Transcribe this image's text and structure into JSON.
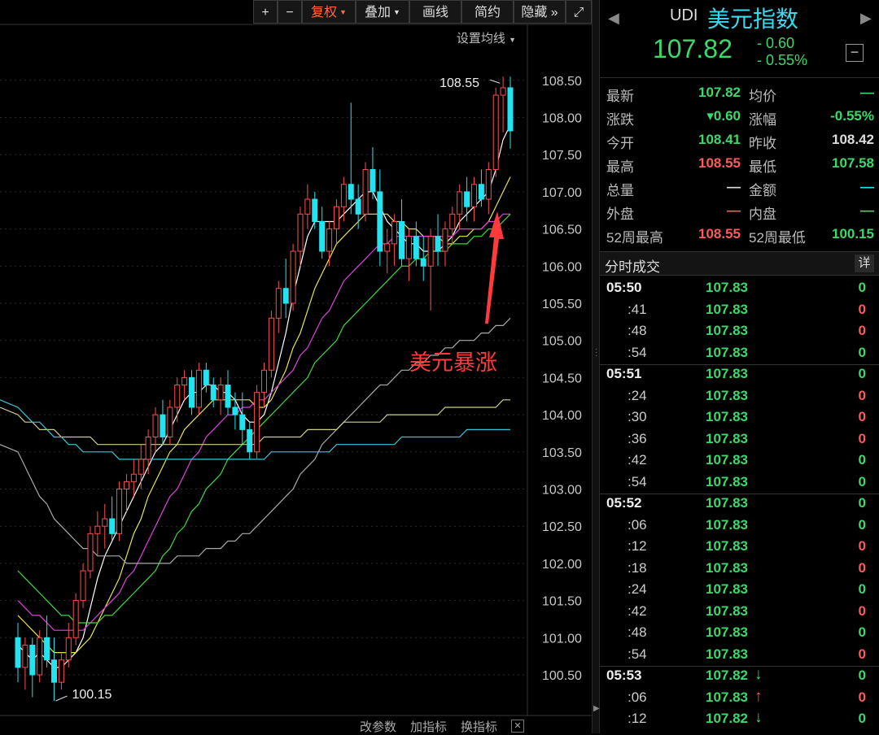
{
  "toolbar": {
    "plus": "+",
    "minus": "−",
    "fuquan": "复权",
    "diejia": "叠加",
    "huaxian": "画线",
    "jiandian": "简约",
    "yincang": "隐藏",
    "more": "»",
    "expand": "⤢"
  },
  "chart": {
    "ma_settings": "设置均线",
    "bottom_tools": [
      "改参数",
      "加指标",
      "换指标"
    ],
    "close_x": "✕",
    "annotation": "美元暴涨",
    "high_label": "108.55",
    "low_label": "100.15",
    "colors": {
      "up": "#ff4d4d",
      "down": "#22e4f0",
      "ma5": "#ffffff",
      "ma10": "#e6e64a",
      "ma20": "#e040e0",
      "ma30": "#3ed93e",
      "ma60": "#aaaaaa",
      "ma120": "#cfcf8a",
      "ma250": "#3bc4d8",
      "annotation": "#ff3a3a"
    }
  },
  "chart_data": {
    "type": "candlestick",
    "y_tick_labels": [
      "108.50",
      "108.00",
      "107.50",
      "107.00",
      "106.50",
      "106.00",
      "105.50",
      "105.00",
      "104.50",
      "104.00",
      "103.50",
      "103.00",
      "102.50",
      "102.00",
      "101.50",
      "101.00",
      "100.50"
    ],
    "ylim": [
      100.2,
      108.7
    ],
    "highest": 108.55,
    "lowest": 100.15,
    "candles": [
      [
        101.0,
        101.2,
        100.4,
        100.6
      ],
      [
        100.6,
        101.0,
        100.3,
        100.9
      ],
      [
        100.9,
        101.0,
        100.2,
        100.5
      ],
      [
        100.5,
        101.1,
        100.4,
        101.0
      ],
      [
        101.0,
        101.3,
        100.6,
        100.7
      ],
      [
        100.7,
        101.0,
        100.15,
        100.4
      ],
      [
        100.4,
        100.8,
        100.3,
        100.7
      ],
      [
        100.7,
        101.2,
        100.6,
        101.0
      ],
      [
        101.0,
        101.6,
        100.9,
        101.5
      ],
      [
        101.5,
        102.0,
        101.4,
        101.9
      ],
      [
        101.9,
        102.5,
        101.8,
        102.4
      ],
      [
        102.4,
        102.7,
        102.1,
        102.5
      ],
      [
        102.5,
        102.8,
        102.2,
        102.6
      ],
      [
        102.6,
        102.9,
        102.3,
        102.4
      ],
      [
        102.4,
        103.1,
        102.3,
        103.0
      ],
      [
        103.0,
        103.2,
        102.7,
        103.1
      ],
      [
        103.1,
        103.4,
        102.9,
        103.2
      ],
      [
        103.2,
        103.6,
        103.0,
        103.4
      ],
      [
        103.4,
        103.8,
        103.2,
        103.7
      ],
      [
        103.7,
        104.1,
        103.5,
        104.0
      ],
      [
        104.0,
        104.2,
        103.6,
        103.7
      ],
      [
        103.7,
        104.2,
        103.6,
        104.1
      ],
      [
        104.1,
        104.5,
        103.9,
        104.4
      ],
      [
        104.4,
        104.6,
        104.2,
        104.5
      ],
      [
        104.5,
        104.6,
        104.0,
        104.1
      ],
      [
        104.1,
        104.7,
        104.0,
        104.6
      ],
      [
        104.6,
        104.7,
        104.3,
        104.4
      ],
      [
        104.4,
        104.5,
        104.1,
        104.2
      ],
      [
        104.2,
        104.5,
        104.0,
        104.4
      ],
      [
        104.4,
        104.6,
        104.0,
        104.1
      ],
      [
        104.1,
        104.3,
        103.8,
        104.0
      ],
      [
        104.0,
        104.3,
        103.6,
        103.8
      ],
      [
        103.8,
        103.9,
        103.4,
        103.5
      ],
      [
        103.5,
        104.4,
        103.4,
        104.3
      ],
      [
        104.3,
        104.7,
        104.1,
        104.6
      ],
      [
        104.6,
        105.4,
        104.5,
        105.3
      ],
      [
        105.3,
        105.8,
        105.1,
        105.7
      ],
      [
        105.7,
        106.1,
        105.3,
        105.5
      ],
      [
        105.5,
        106.3,
        105.4,
        106.2
      ],
      [
        106.2,
        106.8,
        106.0,
        106.7
      ],
      [
        106.7,
        107.1,
        106.5,
        106.9
      ],
      [
        106.9,
        107.0,
        106.5,
        106.6
      ],
      [
        106.6,
        106.8,
        106.1,
        106.2
      ],
      [
        106.2,
        106.6,
        106.0,
        106.5
      ],
      [
        106.5,
        106.9,
        106.3,
        106.8
      ],
      [
        106.8,
        107.2,
        106.6,
        107.1
      ],
      [
        107.1,
        108.2,
        106.7,
        106.9
      ],
      [
        106.9,
        107.1,
        106.5,
        106.7
      ],
      [
        106.7,
        107.4,
        106.6,
        107.3
      ],
      [
        107.3,
        107.6,
        106.9,
        107.0
      ],
      [
        107.0,
        107.3,
        106.0,
        106.2
      ],
      [
        106.2,
        106.5,
        105.9,
        106.3
      ],
      [
        106.3,
        106.7,
        106.0,
        106.6
      ],
      [
        106.6,
        106.9,
        106.0,
        106.1
      ],
      [
        106.1,
        106.5,
        105.8,
        106.4
      ],
      [
        106.4,
        106.6,
        106.0,
        106.1
      ],
      [
        106.1,
        106.4,
        105.8,
        106.0
      ],
      [
        106.0,
        106.5,
        105.4,
        106.4
      ],
      [
        106.4,
        106.7,
        106.0,
        106.2
      ],
      [
        106.2,
        106.6,
        106.0,
        106.5
      ],
      [
        106.5,
        106.8,
        106.3,
        106.7
      ],
      [
        106.7,
        107.1,
        106.5,
        107.0
      ],
      [
        107.0,
        107.2,
        106.6,
        106.8
      ],
      [
        106.8,
        107.2,
        106.6,
        107.1
      ],
      [
        107.1,
        107.3,
        106.8,
        106.9
      ],
      [
        106.9,
        107.4,
        106.7,
        107.3
      ],
      [
        107.3,
        108.4,
        107.2,
        108.3
      ],
      [
        108.3,
        108.55,
        107.8,
        108.4
      ],
      [
        108.4,
        108.55,
        107.58,
        107.82
      ]
    ],
    "ma_series": [
      {
        "key": "ma5",
        "values": [
          100.9,
          100.8,
          100.7,
          100.8,
          100.7,
          100.6,
          100.6,
          100.7,
          100.8,
          101.0,
          101.4,
          101.8,
          102.1,
          102.3,
          102.5,
          102.7,
          102.9,
          103.1,
          103.3,
          103.5,
          103.6,
          103.8,
          104.0,
          104.2,
          104.3,
          104.3,
          104.4,
          104.4,
          104.3,
          104.3,
          104.2,
          104.0,
          103.9,
          103.9,
          104.0,
          104.3,
          104.7,
          105.1,
          105.6,
          106.0,
          106.4,
          106.6,
          106.6,
          106.6,
          106.6,
          106.7,
          106.8,
          106.9,
          107.0,
          107.0,
          106.8,
          106.6,
          106.5,
          106.4,
          106.3,
          106.3,
          106.2,
          106.2,
          106.2,
          106.3,
          106.4,
          106.6,
          106.7,
          106.8,
          106.9,
          107.0,
          107.3,
          107.7,
          107.9
        ]
      },
      {
        "key": "ma10",
        "values": [
          101.3,
          101.2,
          101.1,
          101.0,
          100.9,
          100.8,
          100.8,
          100.8,
          100.8,
          100.9,
          101.0,
          101.2,
          101.4,
          101.6,
          101.8,
          102.1,
          102.4,
          102.6,
          102.9,
          103.1,
          103.3,
          103.5,
          103.6,
          103.8,
          103.9,
          104.0,
          104.1,
          104.2,
          104.2,
          104.2,
          104.2,
          104.2,
          104.2,
          104.1,
          104.1,
          104.2,
          104.4,
          104.6,
          104.9,
          105.1,
          105.4,
          105.7,
          105.9,
          106.1,
          106.3,
          106.4,
          106.5,
          106.6,
          106.7,
          106.7,
          106.7,
          106.7,
          106.6,
          106.6,
          106.5,
          106.5,
          106.4,
          106.4,
          106.4,
          106.3,
          106.3,
          106.4,
          106.4,
          106.5,
          106.5,
          106.6,
          106.8,
          107.0,
          107.2
        ]
      },
      {
        "key": "ma20",
        "values": [
          101.5,
          101.4,
          101.3,
          101.3,
          101.2,
          101.1,
          101.1,
          101.1,
          101.1,
          101.1,
          101.2,
          101.3,
          101.4,
          101.5,
          101.6,
          101.8,
          101.9,
          102.1,
          102.3,
          102.5,
          102.7,
          102.9,
          103.0,
          103.2,
          103.4,
          103.5,
          103.7,
          103.8,
          103.9,
          104.0,
          104.0,
          104.1,
          104.1,
          104.2,
          104.2,
          104.3,
          104.4,
          104.5,
          104.6,
          104.8,
          104.9,
          105.1,
          105.3,
          105.4,
          105.6,
          105.8,
          105.9,
          106.0,
          106.1,
          106.2,
          106.3,
          106.3,
          106.4,
          106.4,
          106.4,
          106.4,
          106.4,
          106.4,
          106.4,
          106.4,
          106.4,
          106.5,
          106.5,
          106.5,
          106.5,
          106.6,
          106.6,
          106.7,
          106.7
        ]
      },
      {
        "key": "ma30",
        "values": [
          101.9,
          101.8,
          101.7,
          101.6,
          101.5,
          101.4,
          101.3,
          101.3,
          101.2,
          101.2,
          101.2,
          101.2,
          101.3,
          101.3,
          101.4,
          101.5,
          101.6,
          101.7,
          101.8,
          101.9,
          102.1,
          102.2,
          102.4,
          102.5,
          102.7,
          102.8,
          103.0,
          103.1,
          103.2,
          103.4,
          103.5,
          103.6,
          103.7,
          103.8,
          103.9,
          104.0,
          104.1,
          104.2,
          104.3,
          104.4,
          104.5,
          104.7,
          104.8,
          104.9,
          105.0,
          105.2,
          105.3,
          105.4,
          105.5,
          105.6,
          105.7,
          105.8,
          105.9,
          106.0,
          106.0,
          106.1,
          106.1,
          106.2,
          106.2,
          106.2,
          106.3,
          106.3,
          106.3,
          106.4,
          106.4,
          106.5,
          106.5,
          106.6,
          106.7
        ]
      },
      {
        "key": "ma60",
        "values": [
          103.5,
          103.3,
          103.1,
          102.9,
          102.8,
          102.6,
          102.5,
          102.4,
          102.3,
          102.2,
          102.2,
          102.1,
          102.1,
          102.1,
          102.1,
          102.0,
          102.0,
          102.0,
          102.0,
          102.0,
          102.0,
          102.0,
          102.1,
          102.1,
          102.1,
          102.1,
          102.2,
          102.2,
          102.2,
          102.3,
          102.3,
          102.4,
          102.4,
          102.5,
          102.6,
          102.7,
          102.8,
          102.9,
          103.0,
          103.2,
          103.3,
          103.4,
          103.6,
          103.7,
          103.8,
          103.9,
          104.0,
          104.1,
          104.2,
          104.3,
          104.4,
          104.4,
          104.5,
          104.6,
          104.6,
          104.7,
          104.7,
          104.8,
          104.8,
          104.9,
          104.9,
          105.0,
          105.0,
          105.0,
          105.1,
          105.1,
          105.2,
          105.2,
          105.3
        ]
      },
      {
        "key": "ma120",
        "values": [
          104.0,
          103.9,
          103.9,
          103.8,
          103.8,
          103.8,
          103.7,
          103.7,
          103.7,
          103.7,
          103.7,
          103.6,
          103.6,
          103.6,
          103.6,
          103.6,
          103.6,
          103.6,
          103.6,
          103.6,
          103.6,
          103.6,
          103.6,
          103.6,
          103.6,
          103.6,
          103.6,
          103.6,
          103.6,
          103.6,
          103.6,
          103.6,
          103.6,
          103.6,
          103.7,
          103.7,
          103.7,
          103.7,
          103.7,
          103.7,
          103.8,
          103.8,
          103.8,
          103.8,
          103.8,
          103.9,
          103.9,
          103.9,
          103.9,
          103.9,
          103.9,
          104.0,
          104.0,
          104.0,
          104.0,
          104.0,
          104.0,
          104.0,
          104.0,
          104.1,
          104.1,
          104.1,
          104.1,
          104.1,
          104.1,
          104.1,
          104.1,
          104.2,
          104.2
        ]
      },
      {
        "key": "ma250",
        "values": [
          104.1,
          104.0,
          103.9,
          103.9,
          103.8,
          103.7,
          103.7,
          103.6,
          103.6,
          103.5,
          103.5,
          103.5,
          103.5,
          103.5,
          103.4,
          103.4,
          103.4,
          103.4,
          103.4,
          103.4,
          103.4,
          103.4,
          103.4,
          103.4,
          103.4,
          103.4,
          103.4,
          103.4,
          103.4,
          103.4,
          103.4,
          103.4,
          103.4,
          103.4,
          103.4,
          103.5,
          103.5,
          103.5,
          103.5,
          103.5,
          103.5,
          103.5,
          103.5,
          103.5,
          103.6,
          103.6,
          103.6,
          103.6,
          103.6,
          103.6,
          103.6,
          103.6,
          103.6,
          103.7,
          103.7,
          103.7,
          103.7,
          103.7,
          103.7,
          103.7,
          103.7,
          103.7,
          103.8,
          103.8,
          103.8,
          103.8,
          103.8,
          103.8,
          103.8
        ]
      }
    ]
  },
  "quote": {
    "code": "UDI",
    "name": "美元指数",
    "last": "107.82",
    "change": "- 0.60",
    "change_pct": "- 0.55%",
    "collapse": "−",
    "rows": [
      {
        "l1": "最新",
        "v1": "107.82",
        "c1": "#3ad96a",
        "l2": "均价",
        "v2": "—",
        "c2": "#3ad96a"
      },
      {
        "l1": "涨跌",
        "v1": "▾0.60",
        "c1": "#3ad96a",
        "l2": "涨幅",
        "v2": "-0.55%",
        "c2": "#3ad96a"
      },
      {
        "l1": "今开",
        "v1": "108.41",
        "c1": "#3ad96a",
        "l2": "昨收",
        "v2": "108.42",
        "c2": "#dddddd"
      },
      {
        "l1": "最高",
        "v1": "108.55",
        "c1": "#ff5a5a",
        "l2": "最低",
        "v2": "107.58",
        "c2": "#3ad96a"
      },
      {
        "l1": "总量",
        "v1": "—",
        "c1": "#dddddd",
        "l2": "金额",
        "v2": "—",
        "c2": "#22e4f0"
      },
      {
        "l1": "外盘",
        "v1": "—",
        "c1": "#ff5a5a",
        "l2": "内盘",
        "v2": "—",
        "c2": "#3ad96a"
      },
      {
        "l1": "52周最高",
        "v1": "108.55",
        "c1": "#ff5a5a",
        "l2": "52周最低",
        "v2": "100.15",
        "c2": "#3ad96a"
      }
    ]
  },
  "ticks": {
    "title": "分时成交",
    "detail": "详",
    "rows": [
      {
        "t": "05:50",
        "major": true,
        "p": "107.83",
        "a": "",
        "v": "0",
        "vc": "#3ad96a"
      },
      {
        "t": ":41",
        "major": false,
        "p": "107.83",
        "a": "",
        "v": "0",
        "vc": "#ff5a5a"
      },
      {
        "t": ":48",
        "major": false,
        "p": "107.83",
        "a": "",
        "v": "0",
        "vc": "#ff5a5a"
      },
      {
        "t": ":54",
        "major": false,
        "p": "107.83",
        "a": "",
        "v": "0",
        "vc": "#3ad96a"
      },
      {
        "t": "05:51",
        "major": true,
        "p": "107.83",
        "a": "",
        "v": "0",
        "vc": "#3ad96a"
      },
      {
        "t": ":24",
        "major": false,
        "p": "107.83",
        "a": "",
        "v": "0",
        "vc": "#ff5a5a"
      },
      {
        "t": ":30",
        "major": false,
        "p": "107.83",
        "a": "",
        "v": "0",
        "vc": "#ff5a5a"
      },
      {
        "t": ":36",
        "major": false,
        "p": "107.83",
        "a": "",
        "v": "0",
        "vc": "#ff5a5a"
      },
      {
        "t": ":42",
        "major": false,
        "p": "107.83",
        "a": "",
        "v": "0",
        "vc": "#3ad96a"
      },
      {
        "t": ":54",
        "major": false,
        "p": "107.83",
        "a": "",
        "v": "0",
        "vc": "#3ad96a"
      },
      {
        "t": "05:52",
        "major": true,
        "p": "107.83",
        "a": "",
        "v": "0",
        "vc": "#3ad96a"
      },
      {
        "t": ":06",
        "major": false,
        "p": "107.83",
        "a": "",
        "v": "0",
        "vc": "#3ad96a"
      },
      {
        "t": ":12",
        "major": false,
        "p": "107.83",
        "a": "",
        "v": "0",
        "vc": "#ff5a5a"
      },
      {
        "t": ":18",
        "major": false,
        "p": "107.83",
        "a": "",
        "v": "0",
        "vc": "#ff5a5a"
      },
      {
        "t": ":24",
        "major": false,
        "p": "107.83",
        "a": "",
        "v": "0",
        "vc": "#3ad96a"
      },
      {
        "t": ":42",
        "major": false,
        "p": "107.83",
        "a": "",
        "v": "0",
        "vc": "#ff5a5a"
      },
      {
        "t": ":48",
        "major": false,
        "p": "107.83",
        "a": "",
        "v": "0",
        "vc": "#3ad96a"
      },
      {
        "t": ":54",
        "major": false,
        "p": "107.83",
        "a": "",
        "v": "0",
        "vc": "#ff5a5a"
      },
      {
        "t": "05:53",
        "major": true,
        "p": "107.82",
        "a": "down",
        "v": "0",
        "vc": "#3ad96a"
      },
      {
        "t": ":06",
        "major": false,
        "p": "107.83",
        "a": "up",
        "v": "0",
        "vc": "#ff5a5a"
      },
      {
        "t": ":12",
        "major": false,
        "p": "107.82",
        "a": "down",
        "v": "0",
        "vc": "#3ad96a"
      }
    ]
  }
}
